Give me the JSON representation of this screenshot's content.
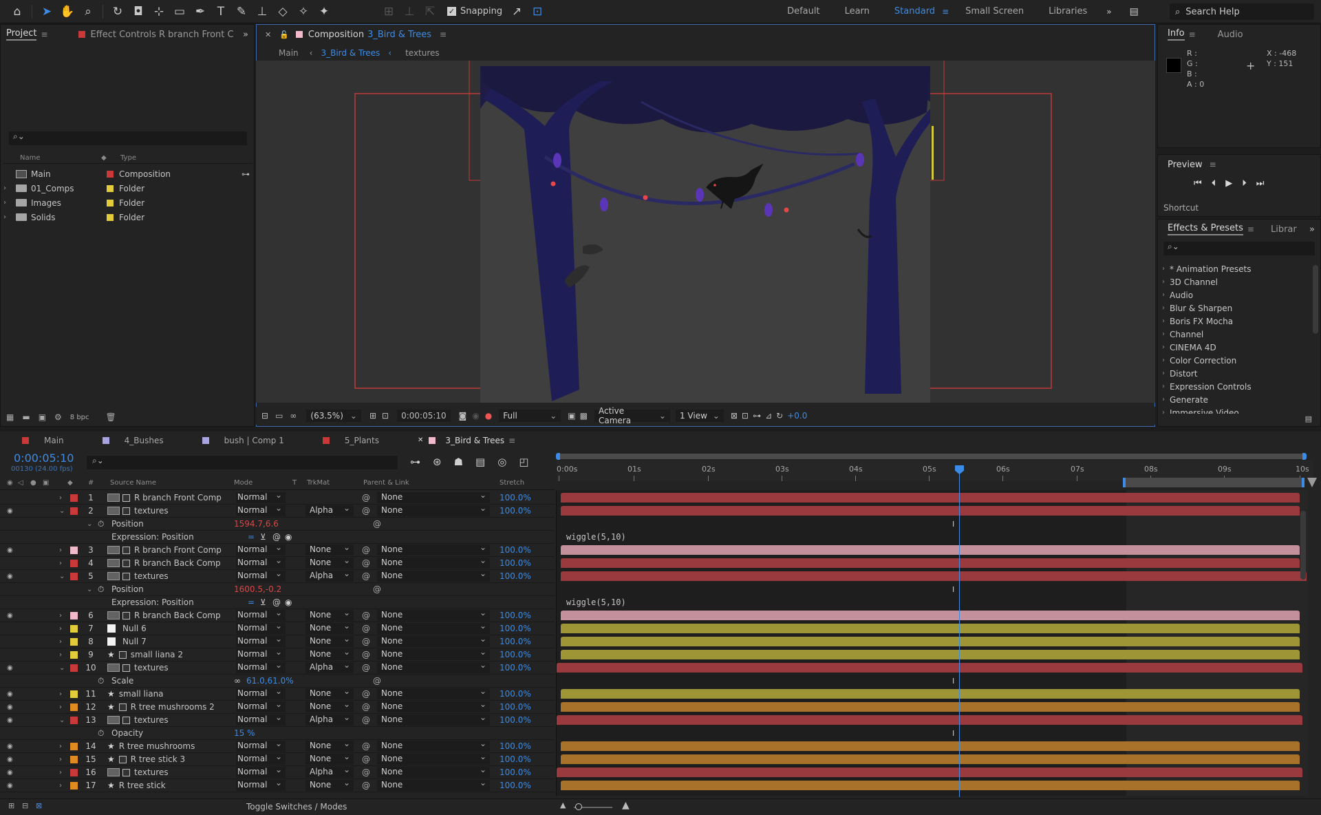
{
  "toolbar": {
    "snapping_label": "Snapping",
    "workspaces": [
      "Default",
      "Learn",
      "Standard",
      "Small Screen",
      "Libraries"
    ],
    "active_workspace": "Standard",
    "search_help_placeholder": "Search Help"
  },
  "project_panel": {
    "tab_project": "Project",
    "tab_effect_controls": "Effect Controls R branch Front C",
    "col_name": "Name",
    "col_type": "Type",
    "items": [
      {
        "name": "Main",
        "type": "Composition",
        "color": "#c9393a"
      },
      {
        "name": "01_Comps",
        "type": "Folder",
        "color": "#e3cc3a"
      },
      {
        "name": "Images",
        "type": "Folder",
        "color": "#e3cc3a"
      },
      {
        "name": "Solids",
        "type": "Folder",
        "color": "#e3cc3a"
      }
    ],
    "bpc_label": "8 bpc"
  },
  "comp_panel": {
    "tab_prefix": "Composition",
    "tab_name": "3_Bird & Trees",
    "breadcrumbs": [
      "Main",
      "3_Bird & Trees",
      "textures"
    ],
    "zoom": "(63.5%)",
    "timecode": "0:00:05:10",
    "resolution": "Full",
    "camera": "Active Camera",
    "view": "1 View",
    "exposure": "+0.0"
  },
  "info_panel": {
    "tab_info": "Info",
    "tab_audio": "Audio",
    "r_label": "R :",
    "g_label": "G :",
    "b_label": "B :",
    "a_label": "A :  0",
    "x_readout": "X : -468",
    "y_readout": "Y : 151"
  },
  "preview_panel": {
    "title": "Preview",
    "shortcut_label": "Shortcut"
  },
  "effects_panel": {
    "tab_effects": "Effects & Presets",
    "tab_libraries": "Librar",
    "items": [
      "* Animation Presets",
      "3D Channel",
      "Audio",
      "Blur & Sharpen",
      "Boris FX Mocha",
      "Channel",
      "CINEMA 4D",
      "Color Correction",
      "Distort",
      "Expression Controls",
      "Generate",
      "Immersive Video"
    ]
  },
  "timeline": {
    "tabs": [
      {
        "name": "Main",
        "color": "#c9393a"
      },
      {
        "name": "4_Bushes",
        "color": "#a9a4e0"
      },
      {
        "name": "bush | Comp 1",
        "color": "#a9a4e0"
      },
      {
        "name": "5_Plants",
        "color": "#c9393a"
      },
      {
        "name": "3_Bird & Trees",
        "color": "#f0b8c8"
      }
    ],
    "timecode": "0:00:05:10",
    "frames": "00130 (24.00 fps)",
    "col_source": "Source Name",
    "col_mode": "Mode",
    "col_t": "T",
    "col_trkmat": "TrkMat",
    "col_parent": "Parent & Link",
    "col_stretch": "Stretch",
    "ruler_labels": [
      "0:00s",
      "01s",
      "02s",
      "03s",
      "04s",
      "05s",
      "06s",
      "07s",
      "08s",
      "09s",
      "10s"
    ],
    "toggle_label": "Toggle Switches / Modes",
    "layers": [
      {
        "num": "1",
        "name": "R branch Front Comp",
        "color": "#c9393a",
        "icon": "comp",
        "mode": "Normal",
        "trk": "",
        "parent": "None",
        "stretch": "100.0%",
        "eye": true,
        "open": false
      },
      {
        "num": "2",
        "name": "textures",
        "color": "#c9393a",
        "icon": "comp",
        "mode": "Normal",
        "trk": "Alpha",
        "parent": "None",
        "stretch": "100.0%",
        "eye": true,
        "open": true
      },
      {
        "num": "3",
        "name": "R branch Front Comp",
        "color": "#f0b8c8",
        "icon": "comp",
        "mode": "Normal",
        "trk": "None",
        "parent": "None",
        "stretch": "100.0%",
        "eye": true,
        "open": false
      },
      {
        "num": "4",
        "name": "R branch Back Comp",
        "color": "#c9393a",
        "icon": "comp",
        "mode": "Normal",
        "trk": "None",
        "parent": "None",
        "stretch": "100.0%",
        "eye": false,
        "open": false
      },
      {
        "num": "5",
        "name": "textures",
        "color": "#c9393a",
        "icon": "comp",
        "mode": "Normal",
        "trk": "Alpha",
        "parent": "None",
        "stretch": "100.0%",
        "eye": true,
        "open": true
      },
      {
        "num": "6",
        "name": "R branch Back Comp",
        "color": "#f0b8c8",
        "icon": "comp",
        "mode": "Normal",
        "trk": "None",
        "parent": "None",
        "stretch": "100.0%",
        "eye": true,
        "open": false
      },
      {
        "num": "7",
        "name": "Null 6",
        "color": "#e3cc3a",
        "icon": "null",
        "mode": "Normal",
        "trk": "None",
        "parent": "None",
        "stretch": "100.0%",
        "eye": false,
        "open": false
      },
      {
        "num": "8",
        "name": "Null 7",
        "color": "#e3cc3a",
        "icon": "null",
        "mode": "Normal",
        "trk": "None",
        "parent": "None",
        "stretch": "100.0%",
        "eye": false,
        "open": false
      },
      {
        "num": "9",
        "name": "small liana 2",
        "color": "#e3cc3a",
        "icon": "shape",
        "mode": "Normal",
        "trk": "None",
        "parent": "None",
        "stretch": "100.0%",
        "eye": false,
        "open": false
      },
      {
        "num": "10",
        "name": "textures",
        "color": "#c9393a",
        "icon": "comp",
        "mode": "Normal",
        "trk": "Alpha",
        "parent": "None",
        "stretch": "100.0%",
        "eye": true,
        "open": true
      },
      {
        "num": "11",
        "name": "small liana",
        "color": "#e3cc3a",
        "icon": "star",
        "mode": "Normal",
        "trk": "None",
        "parent": "None",
        "stretch": "100.0%",
        "eye": true,
        "open": false
      },
      {
        "num": "12",
        "name": "R tree mushrooms 2",
        "color": "#e08a22",
        "icon": "shape",
        "mode": "Normal",
        "trk": "None",
        "parent": "None",
        "stretch": "100.0%",
        "eye": true,
        "open": false
      },
      {
        "num": "13",
        "name": "textures",
        "color": "#c9393a",
        "icon": "comp",
        "mode": "Normal",
        "trk": "Alpha",
        "parent": "None",
        "stretch": "100.0%",
        "eye": true,
        "open": true
      },
      {
        "num": "14",
        "name": "R tree mushrooms",
        "color": "#e08a22",
        "icon": "star",
        "mode": "Normal",
        "trk": "None",
        "parent": "None",
        "stretch": "100.0%",
        "eye": true,
        "open": false
      },
      {
        "num": "15",
        "name": "R tree stick 3",
        "color": "#e08a22",
        "icon": "shape",
        "mode": "Normal",
        "trk": "None",
        "parent": "None",
        "stretch": "100.0%",
        "eye": true,
        "open": false
      },
      {
        "num": "16",
        "name": "textures",
        "color": "#c9393a",
        "icon": "comp",
        "mode": "Normal",
        "trk": "Alpha",
        "parent": "None",
        "stretch": "100.0%",
        "eye": true,
        "open": false
      },
      {
        "num": "17",
        "name": "R tree stick",
        "color": "#e08a22",
        "icon": "star",
        "mode": "Normal",
        "trk": "None",
        "parent": "None",
        "stretch": "100.0%",
        "eye": true,
        "open": false
      }
    ],
    "props": {
      "p2_name": "Position",
      "p2_value": "1594.7,6.6",
      "p2_expr": "Expression: Position",
      "p2_code": "wiggle(5,10)",
      "p5_name": "Position",
      "p5_value": "1600.5,-0.2",
      "p5_expr": "Expression: Position",
      "p5_code": "wiggle(5,10)",
      "p10_name": "Scale",
      "p10_value": "61.0,61.0%",
      "p13_name": "Opacity",
      "p13_value": "15 %"
    }
  },
  "colors": {
    "accent": "#3c8ce7",
    "label_red": "#c9393a",
    "label_pink": "#f0b8c8",
    "label_yellow": "#e3cc3a",
    "label_orange": "#e08a22",
    "bar_red": "#9a3a3f",
    "bar_pink": "#c4909c",
    "bar_yellow": "#9e9536",
    "bar_orange": "#a8722a"
  }
}
